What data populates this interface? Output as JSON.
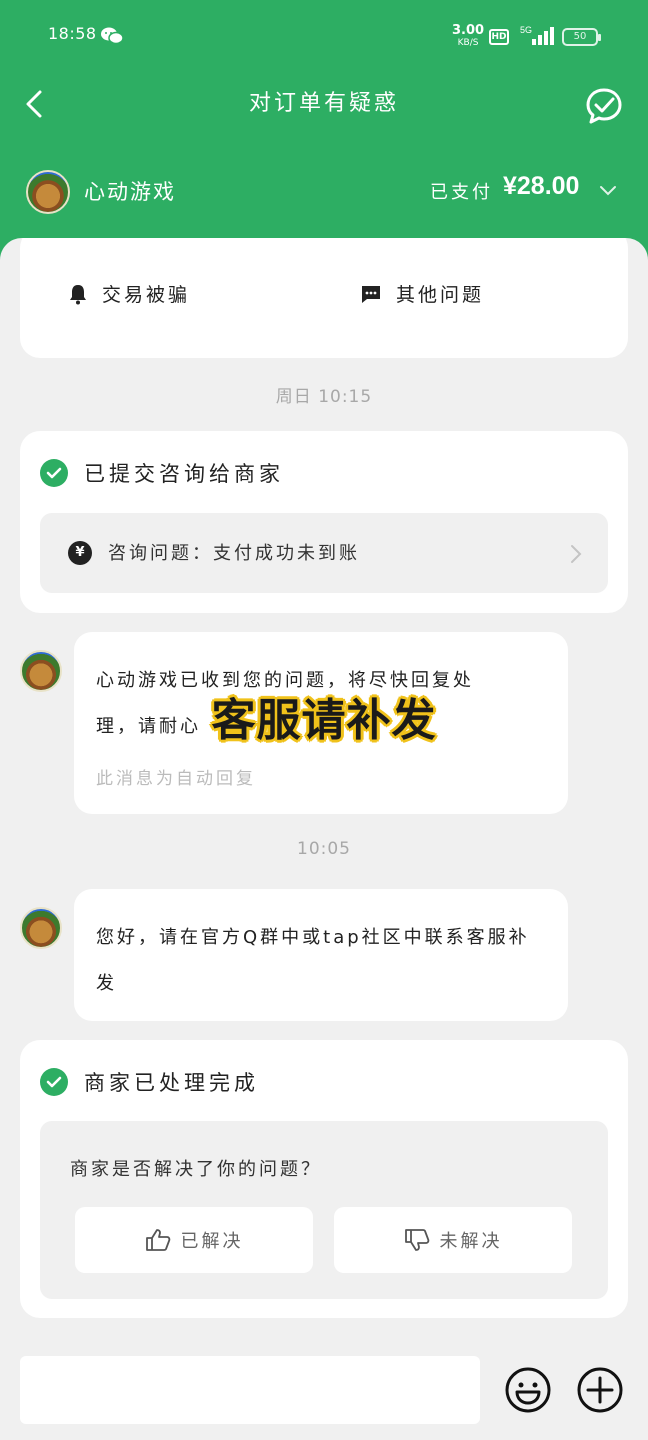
{
  "status_bar": {
    "time": "18:58",
    "net_speed": "3.00",
    "net_unit": "KB/S",
    "hd": "HD",
    "network": "5G",
    "battery": "50"
  },
  "nav": {
    "title": "对订单有疑惑"
  },
  "merchant": {
    "name": "心动游戏",
    "order_status": "已支付",
    "amount": "¥28.00"
  },
  "issue_types": [
    {
      "label": "交易被骗",
      "icon": "bell-icon"
    },
    {
      "label": "其他问题",
      "icon": "message-icon"
    }
  ],
  "timeline": {
    "timestamp_1": "周日 10:15",
    "timestamp_2": "10:05"
  },
  "submitted": {
    "title": "已提交咨询给商家",
    "inquiry_icon": "yen-icon",
    "inquiry_text": "咨询问题：支付成功未到账"
  },
  "messages": [
    {
      "text_line1": "心动游戏已收到您的问题，将尽快回复处",
      "text_line2": "理，请耐心",
      "note": "此消息为自动回复"
    },
    {
      "text_line1": "您好，请在官方Q群中或tap社区中联系客服补",
      "text_line2": "发"
    }
  ],
  "overlay_caption": "客服请补发",
  "resolved": {
    "title": "商家已处理完成",
    "question": "商家是否解决了你的问题？",
    "yes_label": "已解决",
    "no_label": "未解决"
  },
  "colors": {
    "brand_green": "#2dae63",
    "page_bg": "#f0f0f0",
    "overlay_outline": "#f0c21b"
  }
}
